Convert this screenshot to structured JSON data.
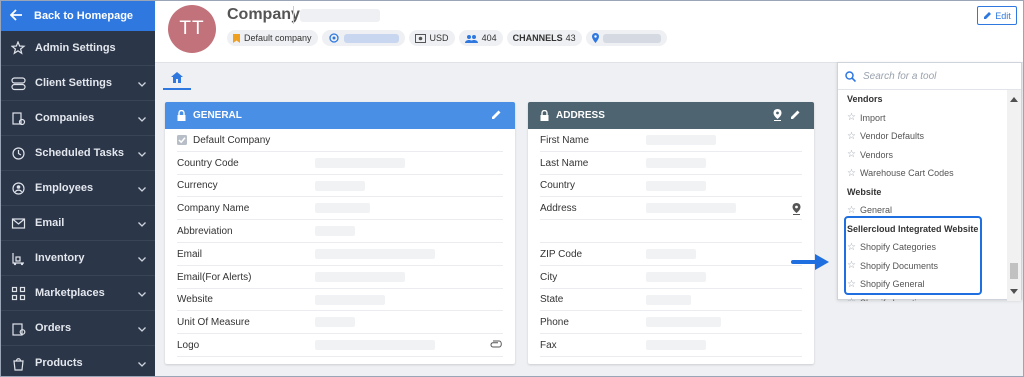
{
  "sidebar": {
    "back_label": "Back to Homepage",
    "items": [
      {
        "label": "Admin Settings",
        "icon": "star-gear-icon",
        "has_chevron": false
      },
      {
        "label": "Client Settings",
        "icon": "toggle-icon",
        "has_chevron": true
      },
      {
        "label": "Companies",
        "icon": "building-gear-icon",
        "has_chevron": true
      },
      {
        "label": "Scheduled Tasks",
        "icon": "clock-icon",
        "has_chevron": true
      },
      {
        "label": "Employees",
        "icon": "user-gear-icon",
        "has_chevron": true
      },
      {
        "label": "Email",
        "icon": "envelope-icon",
        "has_chevron": true
      },
      {
        "label": "Inventory",
        "icon": "inventory-icon",
        "has_chevron": true
      },
      {
        "label": "Marketplaces",
        "icon": "marketplace-icon",
        "has_chevron": true
      },
      {
        "label": "Orders",
        "icon": "orders-icon",
        "has_chevron": true
      },
      {
        "label": "Products",
        "icon": "products-icon",
        "has_chevron": true
      }
    ]
  },
  "header": {
    "avatar_initials": "TT",
    "title": "Company",
    "edit_label": "Edit",
    "badges": {
      "default_company": "Default company",
      "currency": "USD",
      "users_count": "404",
      "channels_label": "CHANNELS",
      "channels_count": "43"
    }
  },
  "general": {
    "title": "GENERAL",
    "default_company_label": "Default Company",
    "fields": [
      "Country Code",
      "Currency",
      "Company Name",
      "Abbreviation",
      "Email",
      "Email(For Alerts)",
      "Website",
      "Unit Of Measure",
      "Logo"
    ]
  },
  "address": {
    "title": "ADDRESS",
    "fields": [
      "First Name",
      "Last Name",
      "Country",
      "Address",
      "",
      "ZIP Code",
      "City",
      "State",
      "Phone",
      "Fax"
    ]
  },
  "tool_panel": {
    "placeholder": "Search for a tool",
    "list": [
      {
        "type": "group",
        "label": "Vendors"
      },
      {
        "type": "item",
        "label": "Import"
      },
      {
        "type": "item",
        "label": "Vendor Defaults"
      },
      {
        "type": "item",
        "label": "Vendors"
      },
      {
        "type": "item",
        "label": "Warehouse Cart Codes"
      },
      {
        "type": "group",
        "label": "Website"
      },
      {
        "type": "item",
        "label": "General"
      },
      {
        "type": "group",
        "label": "Sellercloud Integrated Website"
      },
      {
        "type": "item",
        "label": "Shopify Categories"
      },
      {
        "type": "item",
        "label": "Shopify Documents"
      },
      {
        "type": "item",
        "label": "Shopify General"
      },
      {
        "type": "item",
        "label": "Shopify Locations"
      }
    ]
  },
  "colors": {
    "sidebar_bg": "#2c3649",
    "accent": "#2f78e0",
    "general_header": "#4a8fe6",
    "address_header": "#4e6470",
    "avatar": "#c2727a"
  }
}
